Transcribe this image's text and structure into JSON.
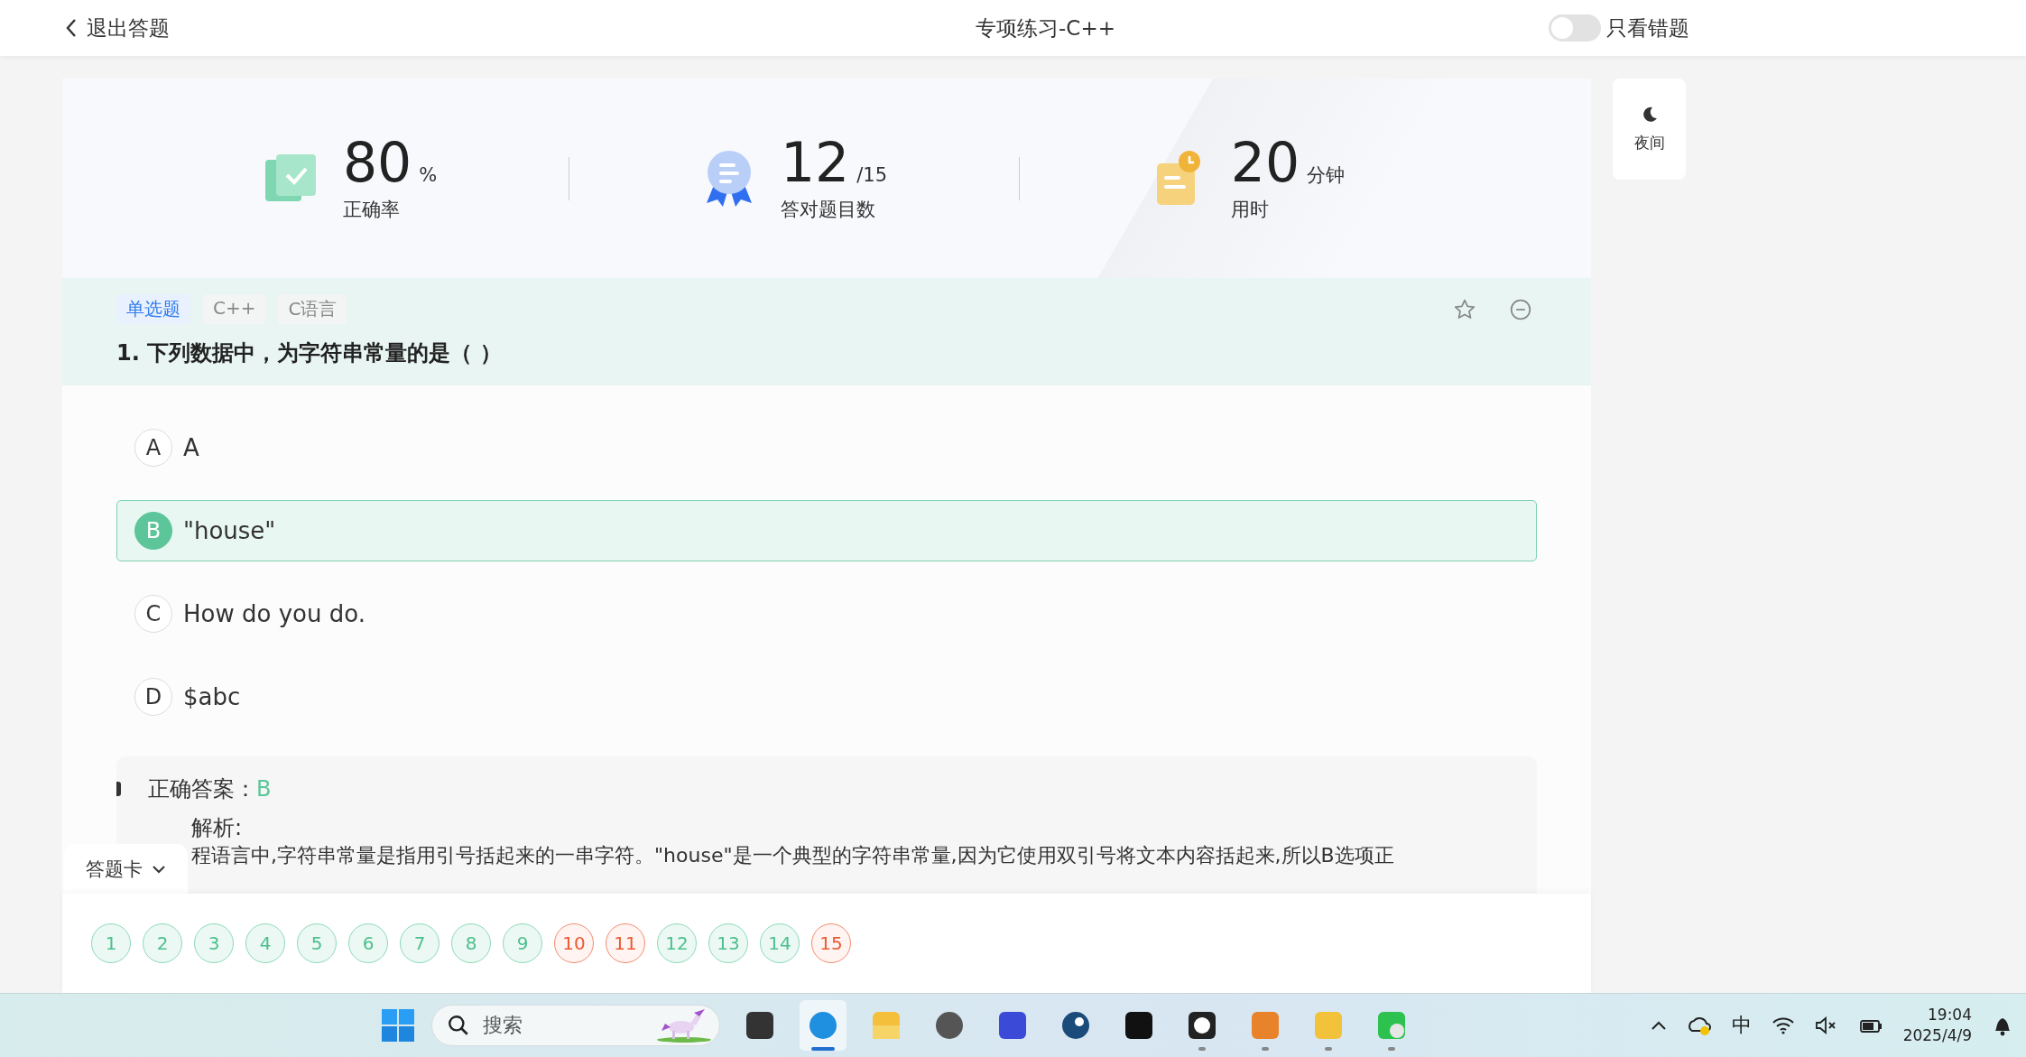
{
  "header": {
    "back": "退出答题",
    "title": "专项练习-C++",
    "wrong_only": {
      "label": "只看错题",
      "on": false
    }
  },
  "stats": [
    {
      "kind": "check",
      "value": "80",
      "unit": "%",
      "label": "正确率"
    },
    {
      "kind": "medal",
      "value": "12",
      "unit": "/15",
      "label": "答对题目数"
    },
    {
      "kind": "clock",
      "value": "20",
      "unit": "分钟",
      "label": "用时"
    }
  ],
  "night_button": "夜间",
  "question": {
    "tags": [
      {
        "label": "单选题",
        "kind": "type"
      },
      {
        "label": "C++",
        "kind": "topic"
      },
      {
        "label": "C语言",
        "kind": "topic"
      }
    ],
    "title": "1. 下列数据中，为字符串常量的是（ ）",
    "options": [
      {
        "letter": "A",
        "text": "A",
        "selected": false
      },
      {
        "letter": "B",
        "text": "\"house\"",
        "selected": true
      },
      {
        "letter": "C",
        "text": "How do you do.",
        "selected": false
      },
      {
        "letter": "D",
        "text": "$abc",
        "selected": false
      }
    ]
  },
  "answer": {
    "label": "正确答案：",
    "value": "B",
    "analysis_label": "解析:",
    "analysis": "程语言中,字符串常量是指用引号括起来的一串字符。\"house\"是一个典型的字符串常量,因为它使用双引号将文本内容括起来,所以B选项正"
  },
  "answer_card": {
    "toggle": "答题卡",
    "items": [
      {
        "label": "1",
        "correct": true
      },
      {
        "label": "2",
        "correct": true
      },
      {
        "label": "3",
        "correct": true
      },
      {
        "label": "4",
        "correct": true
      },
      {
        "label": "5",
        "correct": true
      },
      {
        "label": "6",
        "correct": true
      },
      {
        "label": "7",
        "correct": true
      },
      {
        "label": "8",
        "correct": true
      },
      {
        "label": "9",
        "correct": true
      },
      {
        "label": "10",
        "correct": false
      },
      {
        "label": "11",
        "correct": false
      },
      {
        "label": "12",
        "correct": true
      },
      {
        "label": "13",
        "correct": true
      },
      {
        "label": "14",
        "correct": true
      },
      {
        "label": "15",
        "correct": false
      }
    ]
  },
  "taskbar": {
    "search_placeholder": "搜索",
    "apps": [
      {
        "kind": "files"
      },
      {
        "kind": "edge",
        "active": true
      },
      {
        "kind": "folder"
      },
      {
        "kind": "unity"
      },
      {
        "kind": "app"
      },
      {
        "kind": "steam"
      },
      {
        "kind": "epic"
      },
      {
        "kind": "qq",
        "running": true
      },
      {
        "kind": "box",
        "running": true
      },
      {
        "kind": "bolt",
        "running": true
      },
      {
        "kind": "wechat",
        "running": true
      }
    ],
    "ime": "中",
    "time": "19:04",
    "date": "2025/4/9"
  }
}
